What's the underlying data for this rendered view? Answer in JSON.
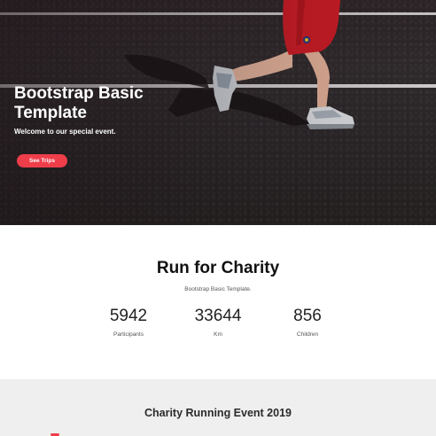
{
  "hero": {
    "title": "Bootstrap Basic Template",
    "subtitle": "Welcome to our special event.",
    "button_label": "See Trips",
    "accent_color": "#ef3e4a"
  },
  "stats_section": {
    "title": "Run for Charity",
    "subtitle": "Bootstrap Basic Template.",
    "stats": [
      {
        "value": "5942",
        "label": "Participants"
      },
      {
        "value": "33644",
        "label": "Km"
      },
      {
        "value": "856",
        "label": "Children"
      }
    ]
  },
  "event_section": {
    "title": "Charity Running Event 2019"
  }
}
